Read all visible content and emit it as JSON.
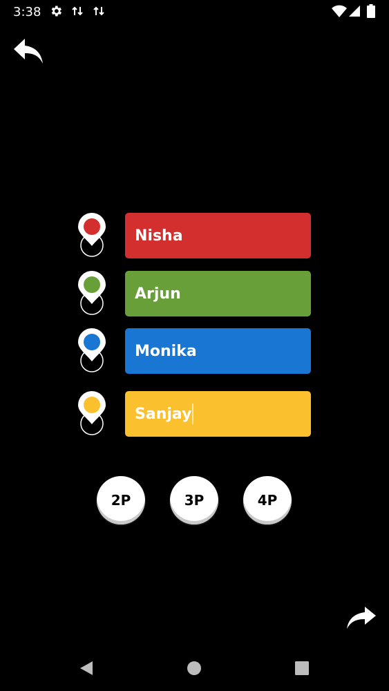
{
  "status_bar": {
    "time": "3:38",
    "icons": [
      "gear-icon",
      "data-transfer-icon",
      "data-transfer-icon",
      "wifi-icon",
      "cell-signal-icon",
      "battery-icon"
    ]
  },
  "players": [
    {
      "name": "Nisha",
      "color": "#d32f2f",
      "pin_color": "#d32f2f"
    },
    {
      "name": "Arjun",
      "color": "#689f38",
      "pin_color": "#689f38"
    },
    {
      "name": "Monika",
      "color": "#1976d2",
      "pin_color": "#1976d2"
    },
    {
      "name": "Sanjay",
      "color": "#fbc02d",
      "pin_color": "#fbc02d"
    }
  ],
  "player_counts": [
    "2P",
    "3P",
    "4P"
  ],
  "icons": {
    "back": "reply-arrow-icon",
    "forward": "forward-arrow-icon",
    "nav": [
      "back-triangle-icon",
      "home-circle-icon",
      "recents-square-icon"
    ]
  }
}
